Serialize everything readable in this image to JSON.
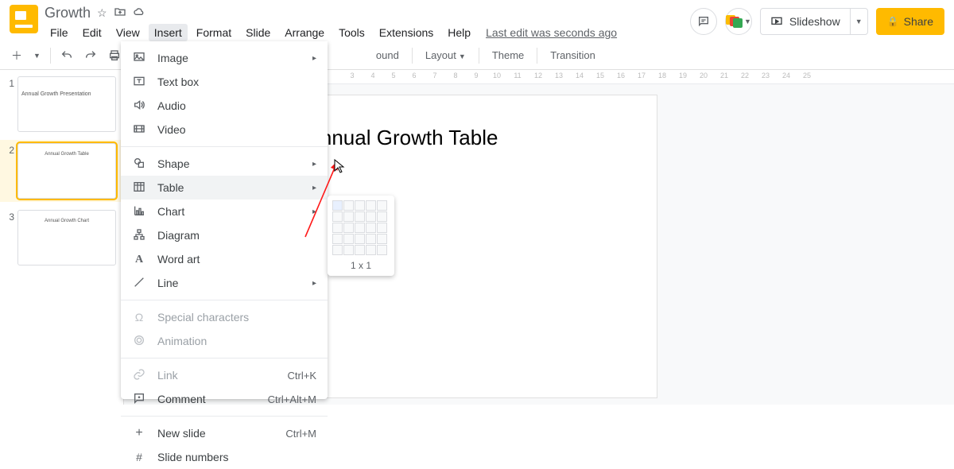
{
  "doc": {
    "title": "Growth"
  },
  "menubar": {
    "items": [
      "File",
      "Edit",
      "View",
      "Insert",
      "Format",
      "Slide",
      "Arrange",
      "Tools",
      "Extensions",
      "Help"
    ],
    "active_index": 3,
    "last_edit": "Last edit was seconds ago"
  },
  "title_actions": {
    "slideshow": "Slideshow",
    "share": "Share"
  },
  "toolbar": {
    "right_labels": {
      "background_trunc": "ound",
      "layout": "Layout",
      "theme": "Theme",
      "transition": "Transition"
    }
  },
  "ruler": {
    "start": 3,
    "end": 25
  },
  "filmstrip": {
    "slides": [
      {
        "num": "1",
        "caption": "Annual Growth Presentation",
        "selected": false
      },
      {
        "num": "2",
        "caption": "Annual Growth Table",
        "selected": true
      },
      {
        "num": "3",
        "caption": "Annual Growth Chart",
        "selected": false
      }
    ]
  },
  "canvas": {
    "title": "Annual Growth Table"
  },
  "insert_menu": {
    "items": [
      {
        "icon": "image",
        "label": "Image",
        "sub": true
      },
      {
        "icon": "textbox",
        "label": "Text box"
      },
      {
        "icon": "audio",
        "label": "Audio"
      },
      {
        "icon": "video",
        "label": "Video"
      },
      {
        "sep": true
      },
      {
        "icon": "shape",
        "label": "Shape",
        "sub": true
      },
      {
        "icon": "table",
        "label": "Table",
        "sub": true,
        "hover": true
      },
      {
        "icon": "chart",
        "label": "Chart",
        "sub": true
      },
      {
        "icon": "diagram",
        "label": "Diagram"
      },
      {
        "icon": "wordart",
        "label": "Word art"
      },
      {
        "icon": "line",
        "label": "Line",
        "sub": true
      },
      {
        "sep": true
      },
      {
        "icon": "spchar",
        "label": "Special characters",
        "disabled": true
      },
      {
        "icon": "anim",
        "label": "Animation",
        "disabled": true
      },
      {
        "sep": true
      },
      {
        "icon": "link",
        "label": "Link",
        "disabled": true,
        "shortcut": "Ctrl+K"
      },
      {
        "icon": "comment",
        "label": "Comment",
        "shortcut": "Ctrl+Alt+M"
      },
      {
        "sep": true
      },
      {
        "icon": "plus",
        "label": "New slide",
        "shortcut": "Ctrl+M"
      },
      {
        "icon": "hash",
        "label": "Slide numbers"
      }
    ]
  },
  "table_flyout": {
    "label": "1 x 1",
    "rows": 5,
    "cols": 5,
    "sel_rows": 1,
    "sel_cols": 1
  }
}
